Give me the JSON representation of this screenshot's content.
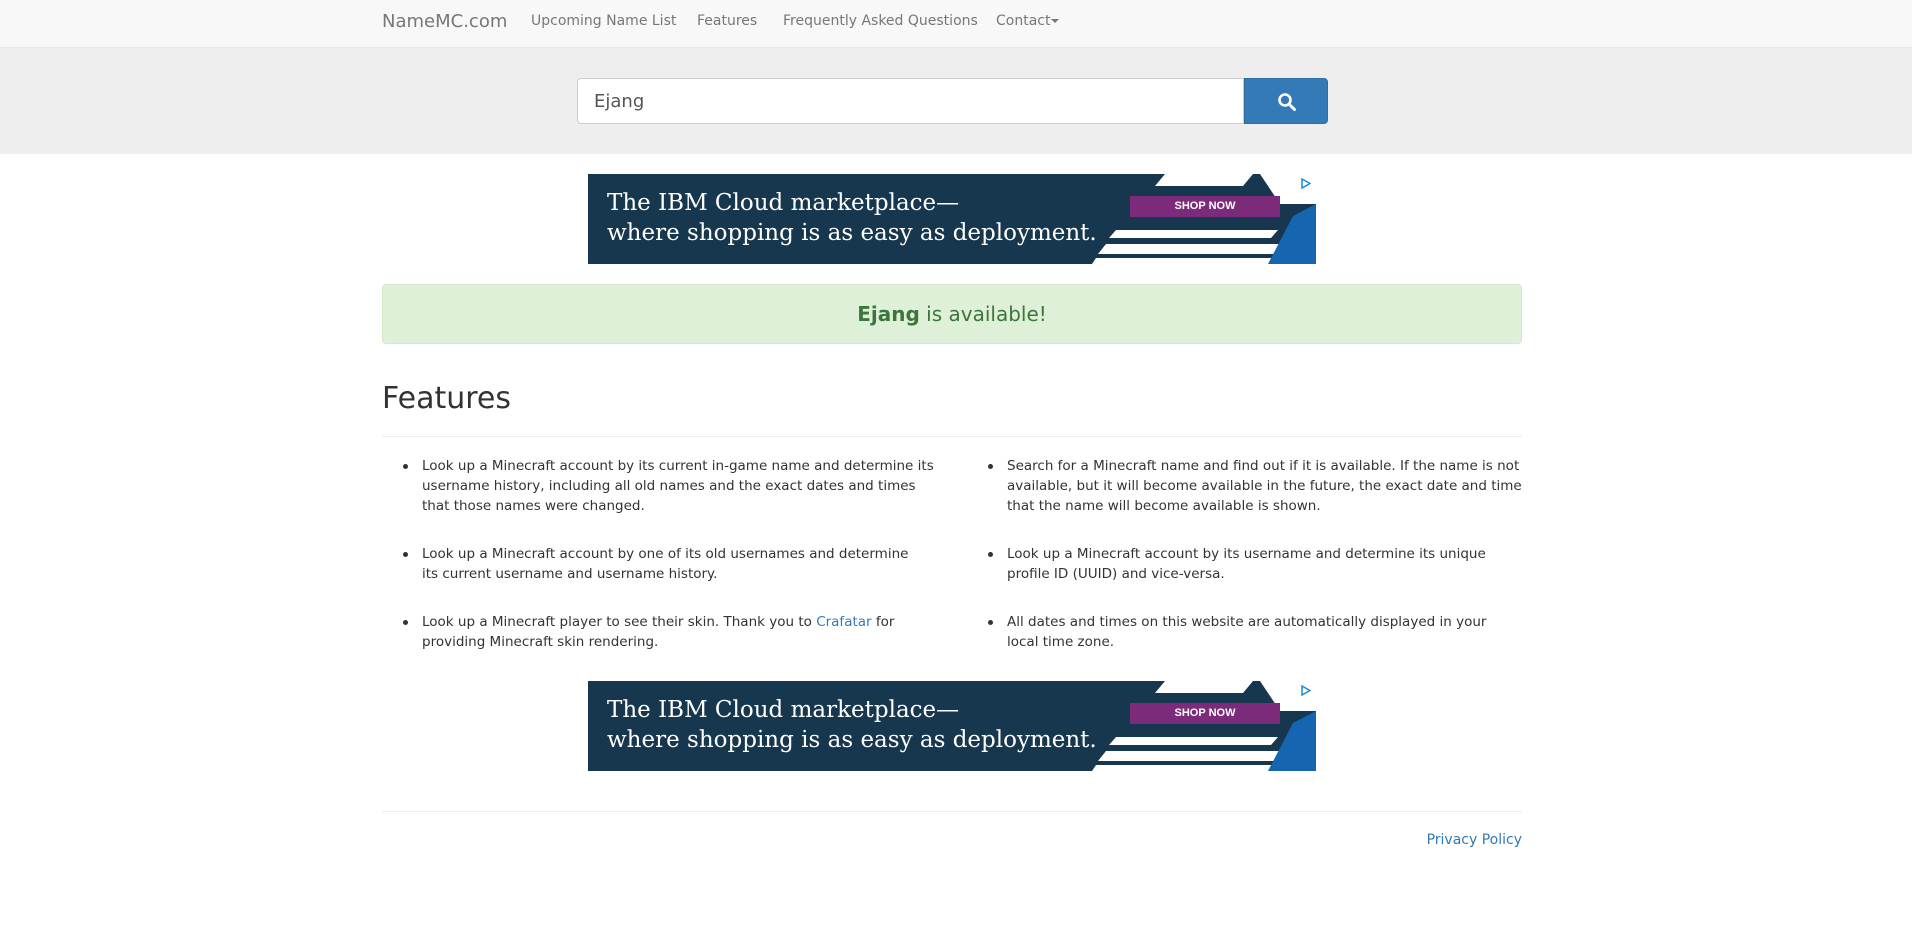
{
  "navbar": {
    "brand": "NameMC.com",
    "links": [
      "Upcoming Name List",
      "Features",
      "Frequently Asked Questions",
      "Contact"
    ]
  },
  "search": {
    "value": "Ejang",
    "button_icon": "search-icon"
  },
  "ads": {
    "line1": "The IBM Cloud marketplace—",
    "line2": "where shopping is as easy as deployment.",
    "cta": "SHOP NOW"
  },
  "alert": {
    "name": "Ejang",
    "message": " is available!"
  },
  "features": {
    "title": "Features",
    "left": [
      "Look up a Minecraft account by its current in-game name and determine its username history, including all old names and the exact dates and times that those names were changed.",
      "Look up a Minecraft account by one of its old usernames and determine its current username and username history."
    ],
    "crafatar_pre": "Look up a Minecraft player to see their skin. Thank you to ",
    "crafatar_link": "Crafatar",
    "crafatar_post": " for providing Minecraft skin rendering.",
    "right": [
      "Search for a Minecraft name and find out if it is available. If the name is not available, but it will become available in the future, the exact date and time that the name will become available is shown.",
      "Look up a Minecraft account by its username and determine its unique profile ID (UUID) and vice-versa.",
      "All dates and times on this website are automatically displayed in your local time zone."
    ]
  },
  "footer": {
    "privacy": "Privacy Policy"
  },
  "colors": {
    "primary": "#337ab7",
    "success_bg": "#dff0d8",
    "success_text": "#3c763d",
    "ad_bg": "#17374f",
    "ad_cta": "#7b2b79"
  }
}
